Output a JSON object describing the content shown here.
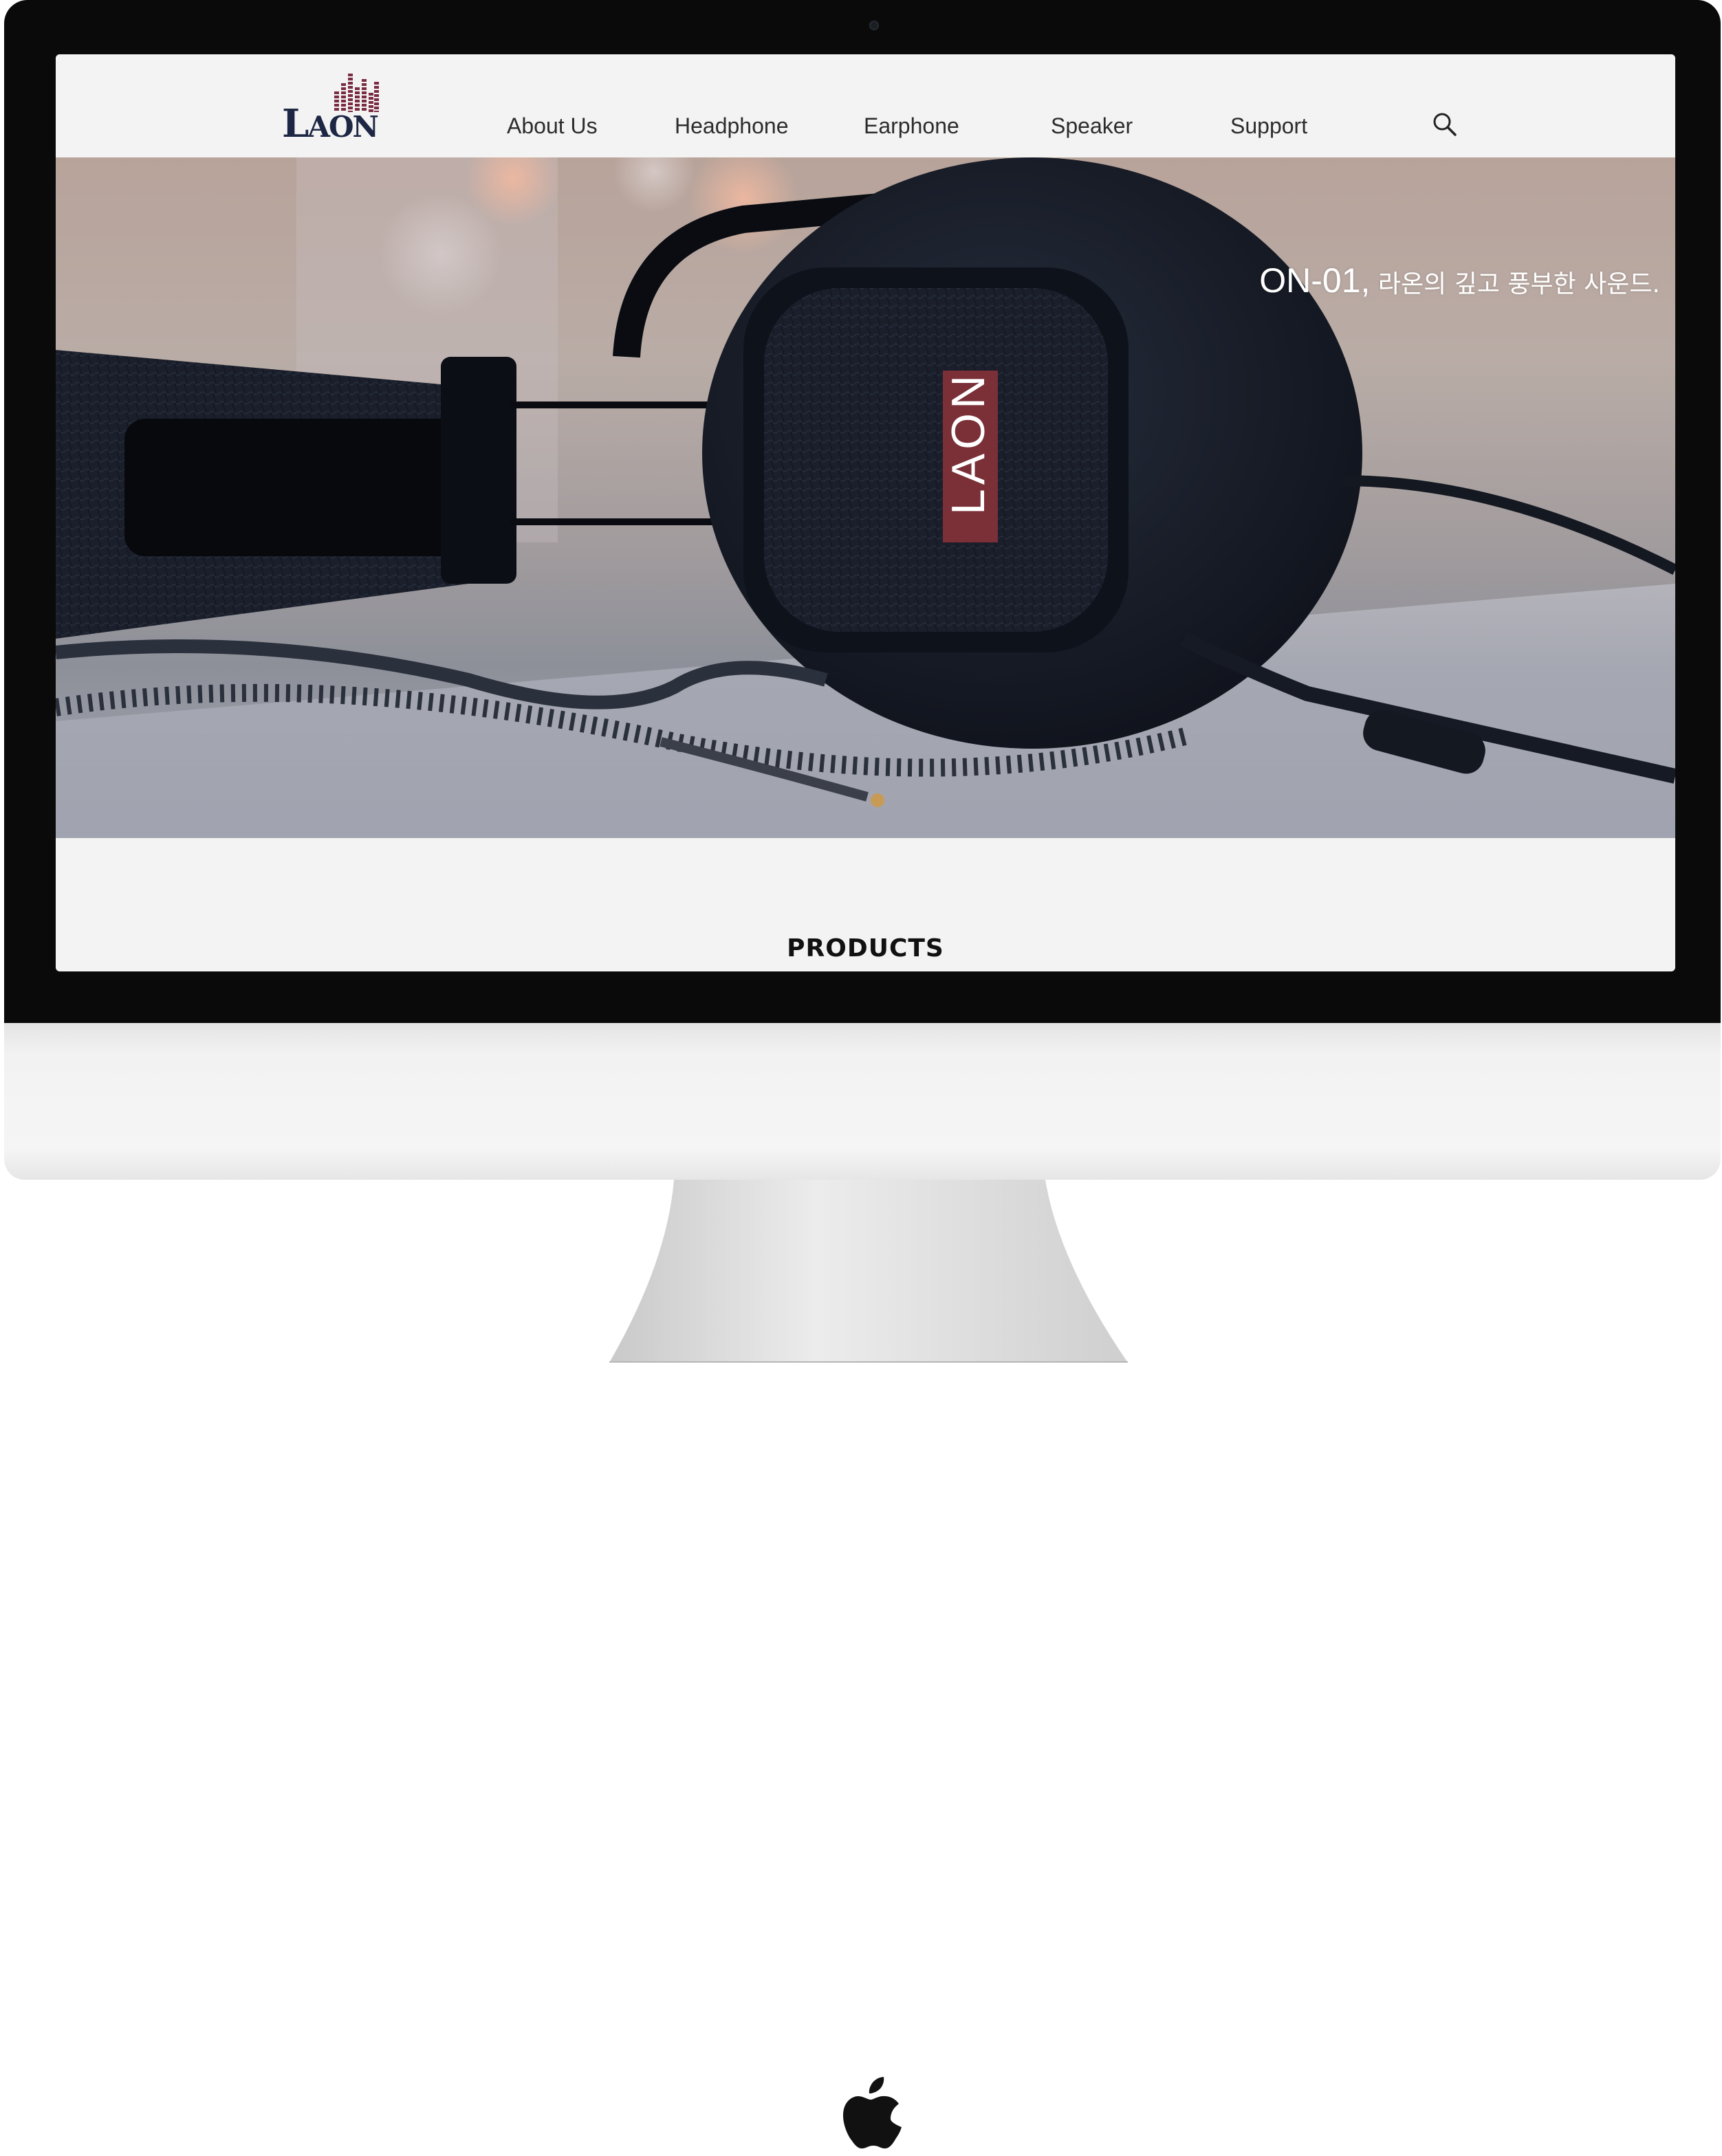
{
  "header": {
    "logo": "LAON",
    "nav": [
      {
        "label": "About Us"
      },
      {
        "label": "Headphone"
      },
      {
        "label": "Earphone"
      },
      {
        "label": "Speaker"
      },
      {
        "label": "Support"
      }
    ],
    "search_icon": "search-icon"
  },
  "hero": {
    "tagline_model": "ON-01,",
    "tagline_text": " 라온의 깊고 풍부한 사운드.",
    "product_label": "LAON",
    "label_color": "#7b2f37"
  },
  "products": {
    "heading": "PRODUCTS"
  },
  "device": {
    "logo_icon": "apple-logo-icon"
  },
  "colors": {
    "brand_navy": "#1d2744",
    "brand_accent": "#7a2c42",
    "page_background": "#f3f3f3"
  }
}
